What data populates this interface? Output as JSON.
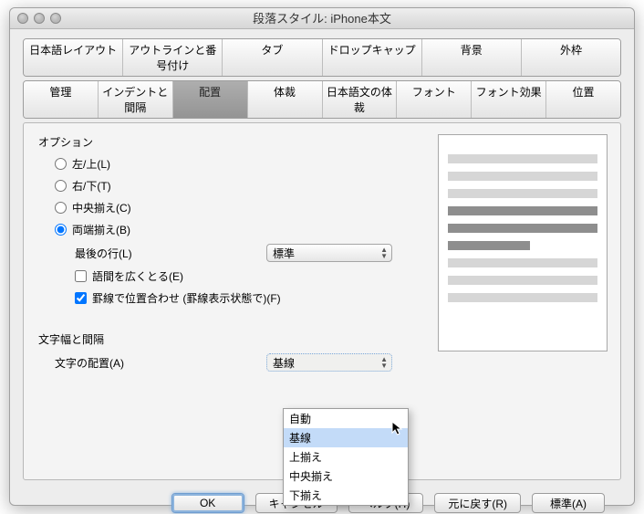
{
  "window": {
    "title": "段落スタイル: iPhone本文"
  },
  "tabs_row1": [
    "日本語レイアウト",
    "アウトラインと番号付け",
    "タブ",
    "ドロップキャップ",
    "背景",
    "外枠"
  ],
  "tabs_row2": [
    "管理",
    "インデントと間隔",
    "配置",
    "体裁",
    "日本語文の体裁",
    "フォント",
    "フォント効果",
    "位置"
  ],
  "tabs_row2_active_index": 2,
  "options": {
    "heading": "オプション",
    "radios": {
      "left_top": "左/上(L)",
      "right_bottom": "右/下(T)",
      "center": "中央揃え(C)",
      "justify": "両端揃え(B)"
    },
    "selected_radio": "justify",
    "last_line": {
      "label": "最後の行(L)",
      "value": "標準"
    },
    "expand_word": {
      "label": "語間を広くとる(E)",
      "checked": false
    },
    "snap_grid": {
      "label": "罫線で位置合わせ (罫線表示状態で)(F)",
      "checked": true
    }
  },
  "char_spacing": {
    "heading": "文字幅と間隔",
    "alignment": {
      "label": "文字の配置(A)",
      "value": "基線"
    },
    "menu": [
      "自動",
      "基線",
      "上揃え",
      "中央揃え",
      "下揃え"
    ],
    "menu_hover_index": 1
  },
  "buttons": {
    "ok": "OK",
    "cancel": "キャンセル",
    "help": "ヘルプ(H)",
    "reset": "元に戻す(R)",
    "standard": "標準(A)"
  }
}
